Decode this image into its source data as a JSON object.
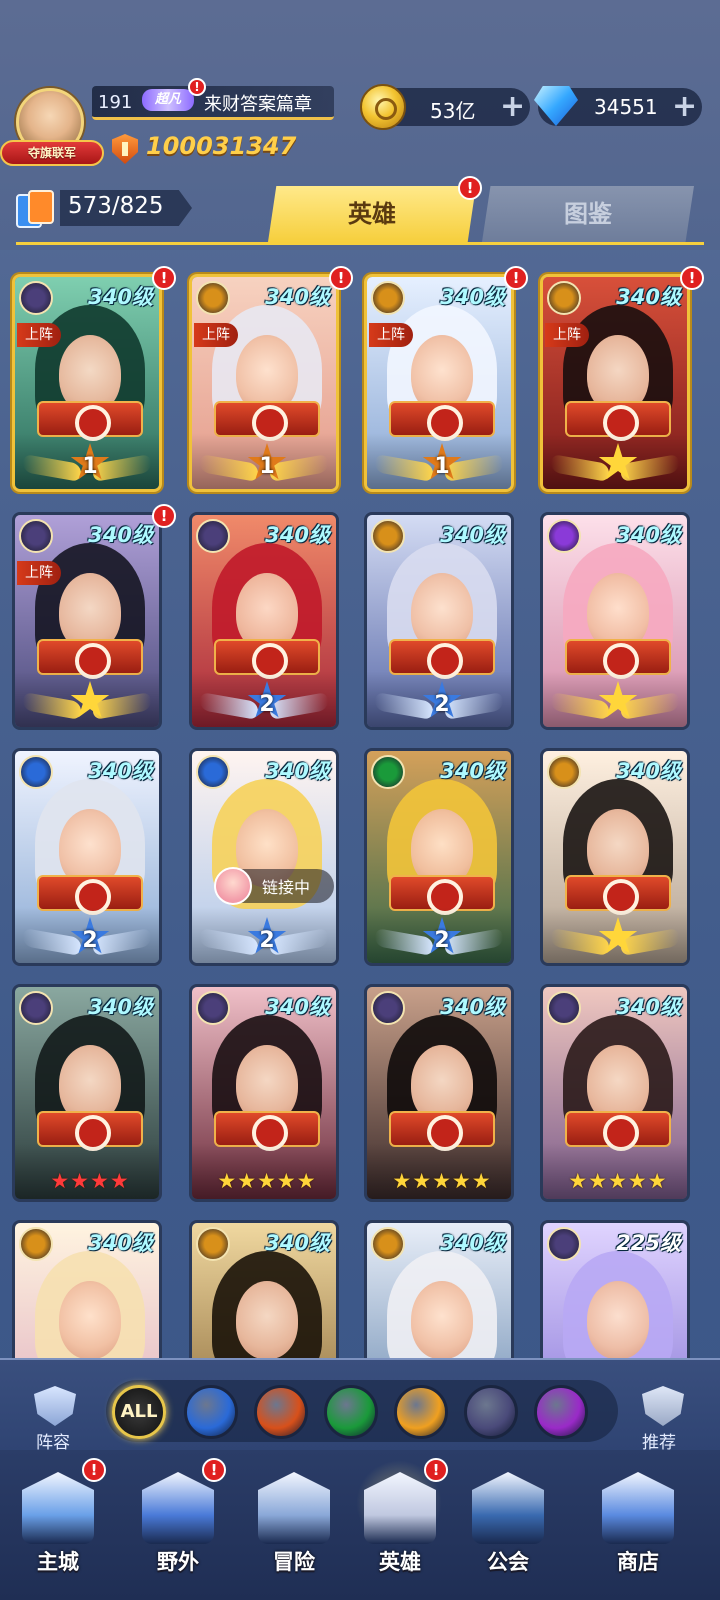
{
  "player": {
    "badge": "夺旗联军",
    "level": "191",
    "vip": "超凡",
    "name": "来财答案篇章",
    "power": "100031347"
  },
  "resources": {
    "gold": "53亿",
    "diamonds": "34551",
    "plus": "+"
  },
  "collection": {
    "count": "573/825"
  },
  "tabs": {
    "heroes": "英雄",
    "gallery": "图鉴"
  },
  "alert_mark": "!",
  "heroes": [
    {
      "level": "340级",
      "faction": "dark",
      "deployed": "上阵",
      "rank": "1",
      "alert": true,
      "palette": [
        "#2a6a5a",
        "#7fcfb0"
      ],
      "hair": "#0f3a2e"
    },
    {
      "level": "340级",
      "faction": "light",
      "deployed": "上阵",
      "rank": "1",
      "alert": true,
      "palette": [
        "#e49a8a",
        "#f7d2c0"
      ],
      "hair": "#e8e8f2"
    },
    {
      "level": "340级",
      "faction": "light",
      "deployed": "上阵",
      "rank": "1",
      "alert": true,
      "palette": [
        "#8aa8d4",
        "#e6f0ff"
      ],
      "hair": "#f2f6ff"
    },
    {
      "level": "340级",
      "faction": "light",
      "deployed": "上阵",
      "rank": "star",
      "alert": true,
      "palette": [
        "#7a1a1a",
        "#d8503a"
      ],
      "hair": "#1a0e0e"
    },
    {
      "level": "340级",
      "faction": "dark",
      "deployed": "上阵",
      "rank": "star",
      "alert": true,
      "palette": [
        "#4a4a7a",
        "#b0a0d8"
      ],
      "hair": "#151522"
    },
    {
      "level": "340级",
      "faction": "dark",
      "deployed": "",
      "rank": "2",
      "alert": false,
      "palette": [
        "#a8283a",
        "#f08a6a"
      ],
      "hair": "#c01a2a"
    },
    {
      "level": "340级",
      "faction": "light",
      "deployed": "",
      "rank": "2",
      "alert": false,
      "palette": [
        "#5a6aa8",
        "#d4dcf4"
      ],
      "hair": "#d8dcf0"
    },
    {
      "level": "340级",
      "faction": "sp",
      "deployed": "",
      "rank": "star",
      "alert": false,
      "palette": [
        "#d48aa8",
        "#fde0ea"
      ],
      "hair": "#f6a8c0"
    },
    {
      "level": "340级",
      "faction": "water",
      "deployed": "",
      "rank": "2",
      "alert": false,
      "palette": [
        "#8aaad4",
        "#f0f4ff"
      ],
      "hair": "#e0e4ee"
    },
    {
      "level": "340级",
      "faction": "water",
      "deployed": "",
      "rank": "2",
      "alert": false,
      "palette": [
        "#b0c8ea",
        "#fff4f0"
      ],
      "hair": "#f6d25a",
      "link": "链接中"
    },
    {
      "level": "340级",
      "faction": "wind",
      "deployed": "",
      "rank": "2",
      "alert": false,
      "palette": [
        "#3a6a4a",
        "#d4a05a"
      ],
      "hair": "#f2c43a"
    },
    {
      "level": "340级",
      "faction": "light",
      "deployed": "",
      "rank": "star",
      "alert": false,
      "palette": [
        "#b0a090",
        "#fff0e0"
      ],
      "hair": "#1a1412"
    },
    {
      "level": "340级",
      "faction": "dark",
      "deployed": "",
      "rank": "★★★★",
      "rank_color": "red",
      "alert": false,
      "palette": [
        "#2a3a3a",
        "#8aa8a0"
      ],
      "hair": "#121a1a"
    },
    {
      "level": "340级",
      "faction": "dark",
      "deployed": "",
      "rank": "★★★★★",
      "rank_color": "gold",
      "alert": false,
      "palette": [
        "#6a2a3a",
        "#f0c0c8"
      ],
      "hair": "#1a0e12"
    },
    {
      "level": "340级",
      "faction": "dark",
      "deployed": "",
      "rank": "★★★★★",
      "rank_color": "gold",
      "alert": false,
      "palette": [
        "#3a2a2a",
        "#c8a08a"
      ],
      "hair": "#0e0a0a"
    },
    {
      "level": "340级",
      "faction": "dark",
      "deployed": "",
      "rank": "★★★★★",
      "rank_color": "gold",
      "alert": false,
      "palette": [
        "#7a5a8a",
        "#f0c8c0"
      ],
      "hair": "#2a1a1a"
    },
    {
      "level": "340级",
      "faction": "light",
      "deployed": "",
      "rank": "",
      "alert": false,
      "palette": [
        "#e0b0c0",
        "#fff4e0"
      ],
      "hair": "#f6e0b0"
    },
    {
      "level": "340级",
      "faction": "light",
      "deployed": "",
      "rank": "",
      "alert": false,
      "palette": [
        "#8a6a3a",
        "#f0d8a0"
      ],
      "hair": "#1a1208"
    },
    {
      "level": "340级",
      "faction": "light",
      "deployed": "",
      "rank": "",
      "alert": false,
      "palette": [
        "#6a8ab0",
        "#e8eef8"
      ],
      "hair": "#f0f0f4"
    },
    {
      "level": "225级",
      "faction": "dark",
      "deployed": "",
      "rank": "",
      "alert": false,
      "palette": [
        "#8a7ad8",
        "#e0d4ff"
      ],
      "hair": "#b8a8f4",
      "level_white": true
    }
  ],
  "filters": {
    "lineup": "阵容",
    "all": "ALL",
    "recommend": "推荐",
    "elements": [
      "water-element-icon",
      "fire-element-icon",
      "wind-element-icon",
      "light-element-icon",
      "dark-element-icon",
      "chaos-element-icon"
    ],
    "element_colors": [
      "#2a6ad8",
      "#d8501a",
      "#1a9a3a",
      "#f0a020",
      "#4a4a7a",
      "#9a2ac8"
    ]
  },
  "nav": [
    {
      "label": "主城",
      "icon": "castle-icon",
      "alert": true
    },
    {
      "label": "野外",
      "icon": "portal-icon",
      "alert": true
    },
    {
      "label": "冒险",
      "icon": "sword-gate-icon",
      "alert": false
    },
    {
      "label": "英雄",
      "icon": "helmet-icon",
      "alert": true,
      "active": true
    },
    {
      "label": "公会",
      "icon": "guild-banner-icon",
      "alert": false
    },
    {
      "label": "商店",
      "icon": "shop-icon",
      "alert": false
    }
  ],
  "faction_colors": {
    "dark": "#4b3f7a",
    "light": "#d8901a",
    "water": "#2a6ad8",
    "wind": "#1a9a3a",
    "sp": "#8a3ad8"
  }
}
